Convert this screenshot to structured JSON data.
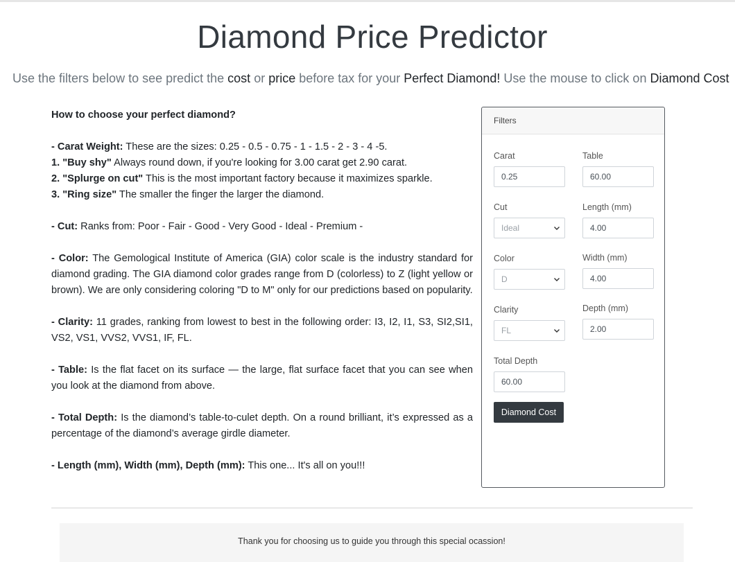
{
  "page": {
    "title": "Diamond Price Predictor",
    "intro": {
      "p1": "Use the filters below to see predict the ",
      "cost": "cost",
      "p2": " or ",
      "price": "price",
      "p3": " before tax for your ",
      "perfect": "Perfect Diamond!",
      "p4": " Use the mouse to click on ",
      "button_ref": "Diamond Cost"
    }
  },
  "guide": {
    "heading": "How to choose your perfect diamond?",
    "carat": {
      "label": "- Carat Weight:",
      "text": " These are the sizes: 0.25 - 0.5 - 0.75 - 1 - 1.5 - 2 - 3 - 4 -5.",
      "tip1_label": "1. \"Buy shy\"",
      "tip1_text": " Always round down, if you're looking for 3.00 carat get 2.90 carat.",
      "tip2_label": "2. \"Splurge on cut\"",
      "tip2_text": " This is the most important factory because it maximizes sparkle.",
      "tip3_label": "3. \"Ring size\"",
      "tip3_text": " The smaller the finger the larger the diamond."
    },
    "cut": {
      "label": "- Cut:",
      "text": " Ranks from: Poor - Fair - Good - Very Good - Ideal - Premium -"
    },
    "color": {
      "label": "- Color:",
      "text": " The Gemological Institute of America (GIA) color scale is the industry standard for diamond grading. The GIA diamond color grades range from D (colorless) to Z (light yellow or brown). We are only considering coloring \"D to M\" only for our predictions based on popularity."
    },
    "clarity": {
      "label": "- Clarity:",
      "text": " 11 grades, ranking from lowest to best in the following order: I3, I2, I1, S3, SI2,SI1, VS2, VS1, VVS2, VVS1, IF, FL."
    },
    "table": {
      "label": "- Table:",
      "text": " Is the flat facet on its surface — the large, flat surface facet that you can see when you look at the diamond from above."
    },
    "total_depth": {
      "label": "- Total Depth:",
      "text": " Is the diamond’s table-to-culet depth. On a round brilliant, it’s expressed as a percentage of the diamond’s average girdle diameter."
    },
    "dims": {
      "label": "- Length (mm), Width (mm), Depth (mm):",
      "text": " This one... It's all on you!!!"
    }
  },
  "filters": {
    "header": "Filters",
    "carat": {
      "label": "Carat",
      "value": "0.25"
    },
    "table": {
      "label": "Table",
      "value": "60.00"
    },
    "cut": {
      "label": "Cut",
      "value": "Ideal"
    },
    "length": {
      "label": "Length (mm)",
      "value": "4.00"
    },
    "color": {
      "label": "Color",
      "value": "D"
    },
    "width": {
      "label": "Width (mm)",
      "value": "4.00"
    },
    "clarity": {
      "label": "Clarity",
      "value": "FL"
    },
    "depth": {
      "label": "Depth (mm)",
      "value": "2.00"
    },
    "total_depth": {
      "label": "Total Depth",
      "value": "60.00"
    },
    "button": "Diamond Cost"
  },
  "footer": {
    "text": "Thank you for choosing us to guide you through this special ocassion!"
  },
  "colors": {
    "button_bg": "#343a40",
    "text": "#212529",
    "muted": "#6c757d",
    "footer_bg": "#f5f5f5"
  }
}
